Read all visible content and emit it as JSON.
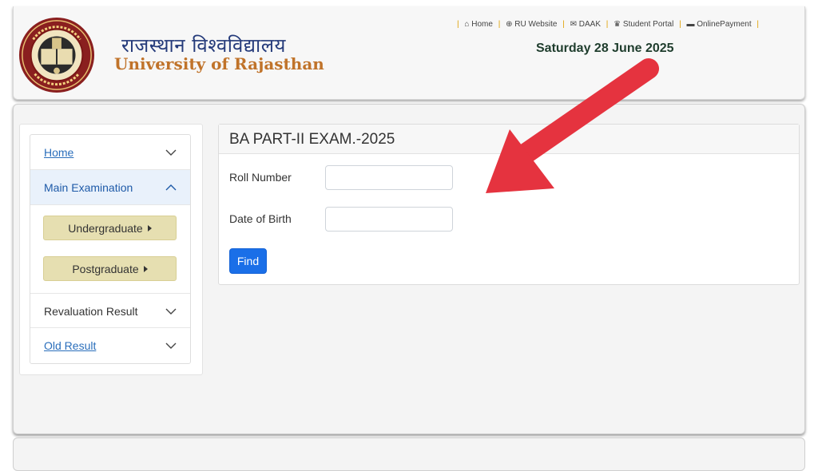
{
  "header": {
    "title_hindi": "राजस्थान विश्वविद्यालय",
    "title_english": "University of Rajasthan",
    "date": "Saturday 28 June 2025",
    "links": [
      {
        "icon": "home-icon",
        "label": "Home"
      },
      {
        "icon": "globe-icon",
        "label": "RU Website"
      },
      {
        "icon": "mail-icon",
        "label": "DAAK"
      },
      {
        "icon": "graduation-icon",
        "label": "Student Portal"
      },
      {
        "icon": "card-icon",
        "label": "OnlinePayment"
      }
    ]
  },
  "sidebar": {
    "items": [
      {
        "label": "Home"
      },
      {
        "label": "Main Examination"
      },
      {
        "label": "Revaluation Result"
      },
      {
        "label": "Old Result"
      }
    ],
    "sub_items": [
      {
        "label": "Undergraduate"
      },
      {
        "label": "Postgraduate"
      }
    ]
  },
  "form": {
    "title": "BA PART-II EXAM.-2025",
    "roll_label": "Roll Number",
    "roll_value": "",
    "dob_label": "Date of Birth",
    "dob_value": "",
    "find_label": "Find"
  },
  "colors": {
    "accent_blue": "#1a6fe8",
    "title_orange": "#c0732a",
    "title_navy": "#243a7a",
    "arrow_red": "#e5333f",
    "submenu_khaki": "#e6dfb1"
  }
}
